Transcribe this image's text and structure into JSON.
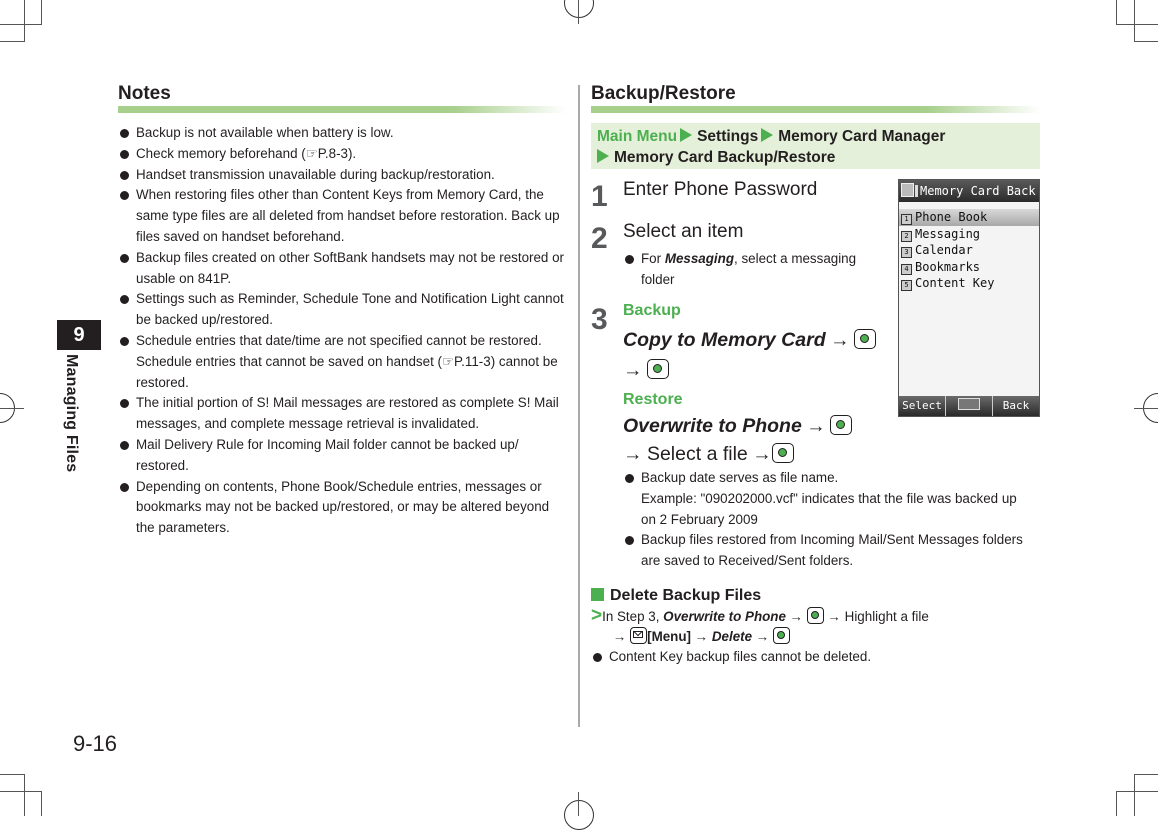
{
  "chapter": {
    "number": "9",
    "title": "Managing Files"
  },
  "page_number": "9-16",
  "notes": {
    "heading": "Notes",
    "items": [
      "Backup is not available when battery is low.",
      "Check memory beforehand (☞P.8-3).",
      "Handset transmission unavailable during backup/restoration.",
      "When restoring files other than Content Keys from Memory Card, the same type files are all deleted from handset before restoration. Back up files saved on handset beforehand.",
      "Backup files created on other SoftBank handsets may not be restored or usable on 841P.",
      "Settings such as Reminder, Schedule Tone and Notification Light cannot be backed up/restored.",
      "Schedule entries that date/time are not specified cannot be restored. Schedule entries that cannot be saved on handset (☞P.11-3) cannot be restored.",
      "The initial portion of S! Mail messages are restored as complete S! Mail messages, and complete message retrieval is invalidated.",
      "Mail Delivery Rule for Incoming Mail folder cannot be backed up/ restored.",
      "Depending on contents, Phone Book/Schedule entries, messages or bookmarks may not be backed up/restored, or may be altered beyond the parameters."
    ]
  },
  "backup_restore": {
    "heading": "Backup/Restore",
    "nav_path": [
      "Main Menu",
      "Settings",
      "Memory Card Manager",
      "Memory Card Backup/Restore"
    ],
    "steps": [
      {
        "number": "1",
        "text": "Enter Phone Password"
      },
      {
        "number": "2",
        "text": "Select an item",
        "note_prefix": "For ",
        "note_emph": "Messaging",
        "note_suffix": ", select a messaging folder"
      },
      {
        "number": "3"
      }
    ],
    "backup": {
      "label": "Backup",
      "operation": "Copy to Memory Card",
      "arrow": "→"
    },
    "restore": {
      "label": "Restore",
      "operation": "Overwrite to Phone",
      "arrow": "→",
      "select_file": "Select a file",
      "notes": [
        "Backup date serves as file name.",
        "Example: \"090202000.vcf\" indicates that the file was backed up on 2 February 2009",
        "Backup files restored from Incoming Mail/Sent Messages folders are saved to Received/Sent folders."
      ]
    },
    "phone_screen": {
      "title": "Memory Card Back",
      "items": [
        {
          "num": "1",
          "label": "Phone Book",
          "selected": true
        },
        {
          "num": "2",
          "label": "Messaging",
          "selected": false
        },
        {
          "num": "3",
          "label": "Calendar",
          "selected": false
        },
        {
          "num": "4",
          "label": "Bookmarks",
          "selected": false
        },
        {
          "num": "5",
          "label": "Content Key",
          "selected": false
        }
      ],
      "softkeys": {
        "left": "Select",
        "right": "Back"
      }
    },
    "delete": {
      "heading": "Delete Backup Files",
      "line1_prefix": "In Step 3, ",
      "line1_op": "Overwrite to Phone",
      "line1_suffix": "Highlight a file",
      "menu_label": "[Menu]",
      "delete_op": "Delete",
      "arrow": "→",
      "note": "Content Key backup files cannot be deleted."
    }
  },
  "colors": {
    "accent_green": "#4caf50",
    "nav_bg": "#e4f0d9",
    "heading_bar": "#a8d08d",
    "tab_bg": "#231f20"
  }
}
